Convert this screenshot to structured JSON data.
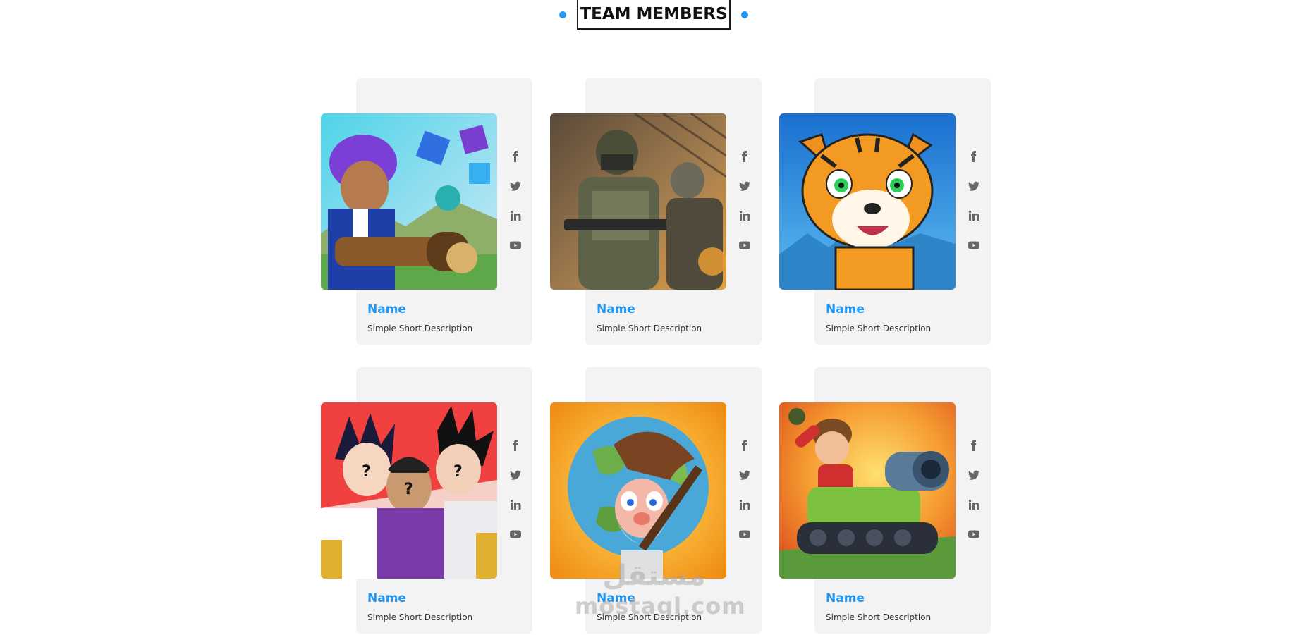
{
  "section": {
    "title": "TEAM MEMBERS"
  },
  "colors": {
    "accent": "#2196f3",
    "card_background": "#f3f3f3",
    "icon": "#666666",
    "title_border": "#1a1a1a"
  },
  "social_icons": [
    "facebook-icon",
    "twitter-icon",
    "linkedin-icon",
    "youtube-icon"
  ],
  "members": [
    {
      "name": "Name",
      "description": "Simple Short Description",
      "image": "cartoon-boy-with-cannon"
    },
    {
      "name": "Name",
      "description": "Simple Short Description",
      "image": "armored-soldiers"
    },
    {
      "name": "Name",
      "description": "Simple Short Description",
      "image": "cartoon-tiger"
    },
    {
      "name": "Name",
      "description": "Simple Short Description",
      "image": "anime-mystery-characters"
    },
    {
      "name": "Name",
      "description": "Simple Short Description",
      "image": "old-miner-with-globe"
    },
    {
      "name": "Name",
      "description": "Simple Short Description",
      "image": "cartoon-tank-soldier"
    }
  ],
  "watermark": {
    "arabic": "مستقل",
    "latin": "mostaql.com"
  }
}
